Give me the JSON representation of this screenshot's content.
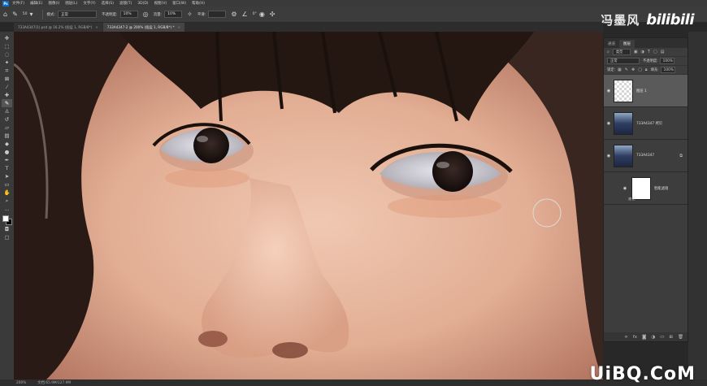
{
  "app": {
    "logo": "Ps",
    "menu": [
      "文件(F)",
      "编辑(E)",
      "图像(I)",
      "图层(L)",
      "文字(Y)",
      "选择(S)",
      "滤镜(T)",
      "3D(D)",
      "视图(V)",
      "窗口(W)",
      "帮助(H)"
    ]
  },
  "options": {
    "brush_size": "50",
    "mode_label": "模式:",
    "mode_value": "正常",
    "opacity_label": "不透明度:",
    "opacity_value": "10%",
    "flow_label": "流量:",
    "flow_value": "10%",
    "smooth_label": "平滑:",
    "smooth_value": "",
    "angle_value": "0°"
  },
  "watermark": {
    "author": "冯墨风",
    "site": "bilibili",
    "bottom": "UiBQ.CoM"
  },
  "tabs": [
    {
      "label": "733A4347(1).psd @ 16.2% (图层 1, RGB/8*)",
      "active": false
    },
    {
      "label": "733A4347-2 @ 200% (图层 1, RGB/8*) *",
      "active": true
    }
  ],
  "layers_panel": {
    "tabs": [
      "图层",
      "通道"
    ],
    "filter_kind": "类型",
    "blend_mode": "正常",
    "opacity_label": "不透明度:",
    "opacity_value": "100%",
    "lock_label": "锁定:",
    "fill_label": "填充:",
    "fill_value": "100%",
    "layers": [
      {
        "name": "图层 1",
        "thumb": "checker",
        "selected": true
      },
      {
        "name": "733A4347 拷贝",
        "thumb": "photo",
        "selected": false
      },
      {
        "name": "733A4347",
        "thumb": "photo",
        "selected": false,
        "smart": true
      }
    ],
    "filter_name": "智能滤镜",
    "filter_sub": "液化"
  },
  "status": {
    "zoom": "200%",
    "doc": "文档:65.9M/127.9M"
  },
  "colors": {
    "accent": "#0c6dcc",
    "panel_bg": "#3d3d3d",
    "selected_layer": "#5a5a5a"
  }
}
